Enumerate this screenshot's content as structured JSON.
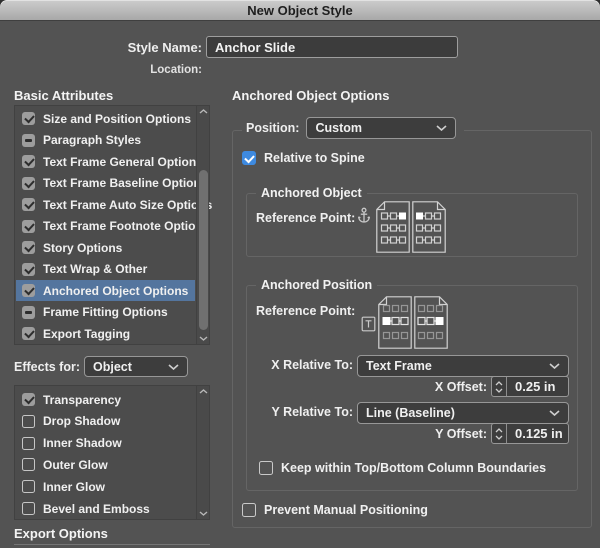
{
  "window": {
    "title": "New Object Style"
  },
  "name_row": {
    "label": "Style Name:",
    "value": "Anchor Slide"
  },
  "location_row": {
    "label": "Location:"
  },
  "left": {
    "heading": "Basic Attributes",
    "attributes": [
      {
        "label": "Size and Position Options",
        "state": "checked",
        "row": ""
      },
      {
        "label": "Paragraph Styles",
        "state": "mixed",
        "row": ""
      },
      {
        "label": "Text Frame General Options",
        "state": "checked",
        "row": ""
      },
      {
        "label": "Text Frame Baseline Options",
        "state": "checked",
        "row": ""
      },
      {
        "label": "Text Frame Auto Size Options",
        "state": "checked",
        "row": ""
      },
      {
        "label": "Text Frame Footnote Options",
        "state": "checked",
        "row": ""
      },
      {
        "label": "Story Options",
        "state": "checked",
        "row": ""
      },
      {
        "label": "Text Wrap & Other",
        "state": "checked",
        "row": ""
      },
      {
        "label": "Anchored Object Options",
        "state": "checked",
        "row": "selected"
      },
      {
        "label": "Frame Fitting Options",
        "state": "mixed",
        "row": ""
      },
      {
        "label": "Export Tagging",
        "state": "checked",
        "row": ""
      }
    ],
    "effects_for": {
      "label": "Effects for:",
      "value": "Object"
    },
    "effects": [
      {
        "label": "Transparency",
        "state": "checked"
      },
      {
        "label": "Drop Shadow",
        "state": "unchecked"
      },
      {
        "label": "Inner Shadow",
        "state": "unchecked"
      },
      {
        "label": "Outer Glow",
        "state": "unchecked"
      },
      {
        "label": "Inner Glow",
        "state": "unchecked"
      },
      {
        "label": "Bevel and Emboss",
        "state": "unchecked"
      }
    ],
    "export_heading": "Export Options"
  },
  "right": {
    "heading": "Anchored Object Options",
    "position": {
      "label": "Position:",
      "value": "Custom"
    },
    "relative_to_spine": {
      "label": "Relative to Spine",
      "checked": true
    },
    "anchored_object": {
      "legend": "Anchored Object",
      "reference_point_label": "Reference Point:"
    },
    "anchored_position": {
      "legend": "Anchored Position",
      "reference_point_label": "Reference Point:",
      "x_relative": {
        "label": "X Relative To:",
        "value": "Text Frame"
      },
      "x_offset": {
        "label": "X Offset:",
        "value": "0.25 in"
      },
      "y_relative": {
        "label": "Y Relative To:",
        "value": "Line (Baseline)"
      },
      "y_offset": {
        "label": "Y Offset:",
        "value": "0.125 in"
      },
      "keep_within": {
        "label": "Keep within Top/Bottom Column Boundaries",
        "checked": false
      }
    },
    "prevent_manual": {
      "label": "Prevent Manual Positioning",
      "checked": false
    }
  },
  "colors": {
    "dialog_bg": "#535353",
    "selection_blue": "#54759e",
    "accent_blue": "#3e8ae0"
  }
}
